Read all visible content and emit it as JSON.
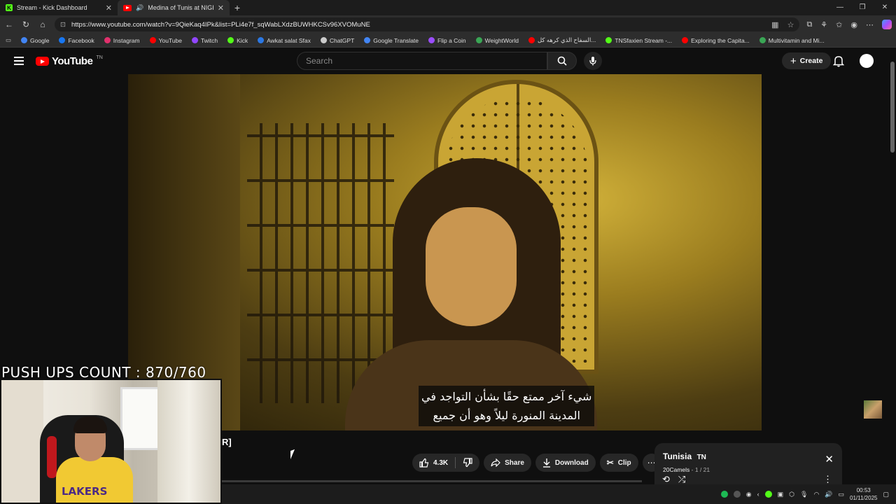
{
  "browser": {
    "tabs": [
      {
        "title": "Stream - Kick Dashboard",
        "close": "✕"
      },
      {
        "title": "Medina of Tunis at NIGHT? ...",
        "close": "✕"
      }
    ],
    "new_tab": "+",
    "url": "https://www.youtube.com/watch?v=9QieKaq4IPk&list=PLi4e7f_sqWabLXdzBUWHKCSv96XVOMuNE",
    "window_controls": [
      "—",
      "❐",
      "✕"
    ],
    "bookmarks": [
      {
        "label": "Google",
        "color": "#4285f4"
      },
      {
        "label": "Facebook",
        "color": "#1877f2"
      },
      {
        "label": "Instagram",
        "color": "#e1306c"
      },
      {
        "label": "YouTube",
        "color": "#ff0000"
      },
      {
        "label": "Twitch",
        "color": "#9146ff"
      },
      {
        "label": "Kick",
        "color": "#53fc18"
      },
      {
        "label": "Awkat salat Sfax",
        "color": "#2b78e4"
      },
      {
        "label": "ChatGPT",
        "color": "#cccccc"
      },
      {
        "label": "Google Translate",
        "color": "#4285f4"
      },
      {
        "label": "Flip a Coin",
        "color": "#9b4dff"
      },
      {
        "label": "WeightWorld",
        "color": "#3aa655"
      },
      {
        "label": "السفاح الذي كرهه كل...",
        "color": "#ff0000"
      },
      {
        "label": "TNSfaxien Stream -...",
        "color": "#53fc18"
      },
      {
        "label": "Exploring the Capita...",
        "color": "#ff0000"
      },
      {
        "label": "Multivitamin and Mi...",
        "color": "#3aa655"
      }
    ]
  },
  "youtube": {
    "logo_text": "YouTube",
    "country_code": "TN",
    "search_placeholder": "Search",
    "create_label": "Create",
    "subtitle_line1": "شيء آخر ممتع حقًا بشأن التواجد في",
    "subtitle_line2": "المدينة المنورة ليلاً وهو أن جميع",
    "title_fragment": "R]",
    "actions": {
      "like_count": "4.3K",
      "share": "Share",
      "download": "Download",
      "clip": "Clip",
      "more": "⋯"
    },
    "playlist": {
      "title": "Tunisia",
      "flag": "TN",
      "channel": "20Camels",
      "position": "1 / 21",
      "close": "✕"
    }
  },
  "overlay": {
    "pushups": "PUSH UPS COUNT : 870/760",
    "jersey_text": "LAKERS"
  },
  "taskbar": {
    "time": "00:53",
    "date": "01/11/2025"
  }
}
